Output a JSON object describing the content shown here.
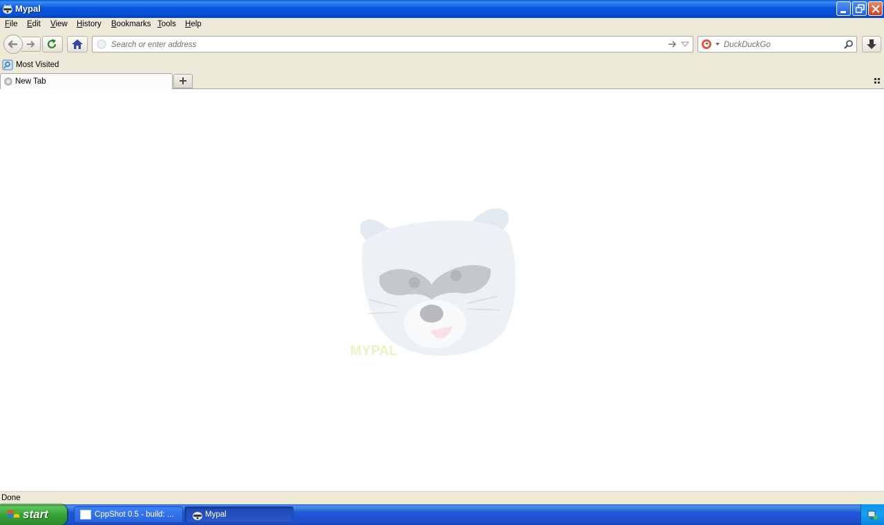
{
  "window": {
    "title": "Mypal"
  },
  "menu": [
    {
      "label": "File",
      "accel": "F",
      "rest": "ile"
    },
    {
      "label": "Edit",
      "accel": "E",
      "rest": "dit"
    },
    {
      "label": "View",
      "accel": "V",
      "rest": "iew"
    },
    {
      "label": "History",
      "accel": "H",
      "rest": "istory"
    },
    {
      "label": "Bookmarks",
      "accel": "B",
      "rest": "ookmarks"
    },
    {
      "label": "Tools",
      "accel": "T",
      "rest": "ools"
    },
    {
      "label": "Help",
      "accel": "H",
      "rest": "elp"
    }
  ],
  "navbar": {
    "address_placeholder": "Search or enter address",
    "search_placeholder": "DuckDuckGo"
  },
  "bookmarks": {
    "most_visited": "Most Visited"
  },
  "tabs": [
    {
      "label": "New Tab"
    }
  ],
  "content": {
    "watermark_text": "MYPAL"
  },
  "status": {
    "text": "Done"
  },
  "taskbar": {
    "start_label": "start",
    "tasks": [
      {
        "label": "CppShot 0.5 - build: ...",
        "active": false
      },
      {
        "label": "Mypal",
        "active": true
      }
    ]
  },
  "colors": {
    "titlebar": "#0855dd",
    "taskbar": "#2157d7",
    "start": "#37a337",
    "chrome": "#ece9d8"
  }
}
